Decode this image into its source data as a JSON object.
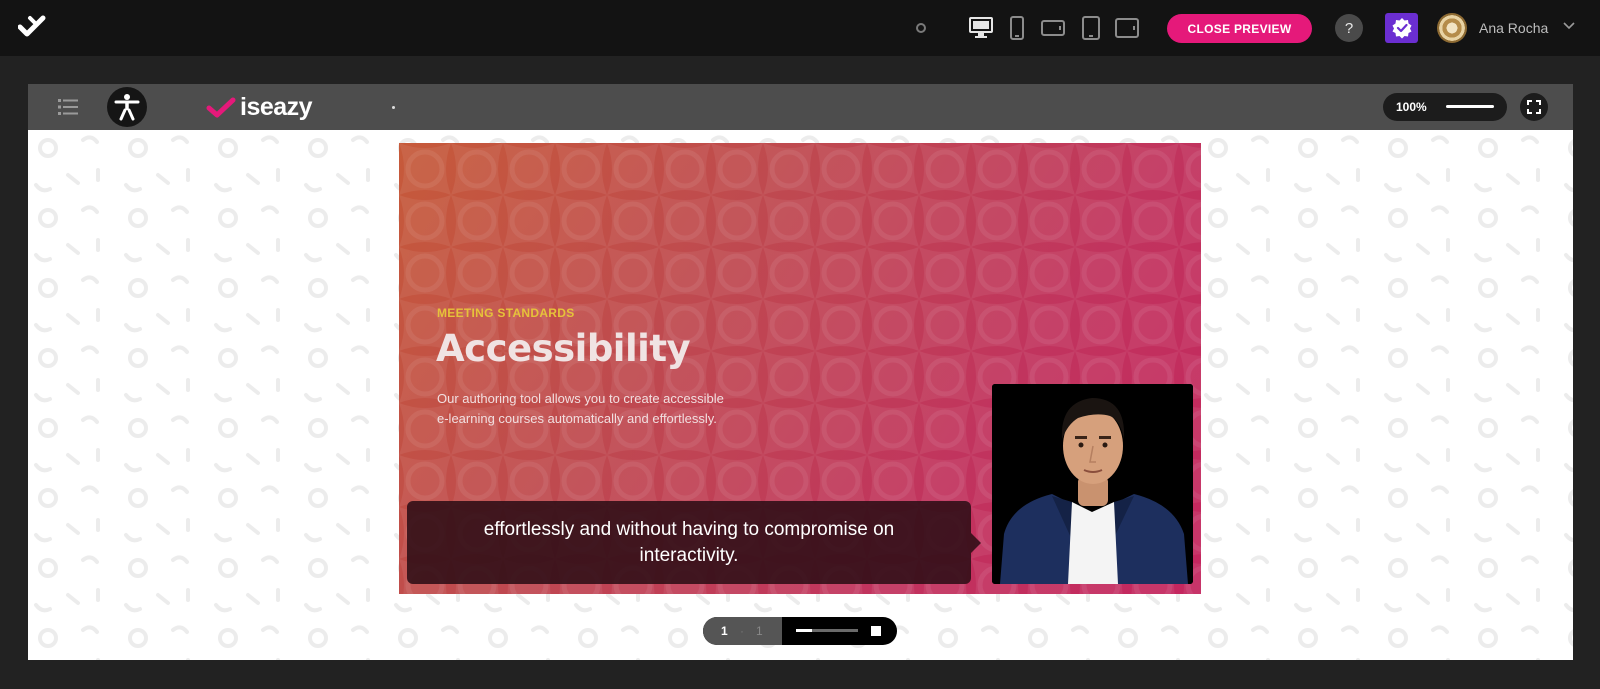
{
  "header": {
    "close_preview_label": "CLOSE PREVIEW",
    "help_label": "?",
    "user_name": "Ana Rocha",
    "devices": [
      "desktop-icon",
      "phone-icon",
      "phone-landscape-icon",
      "tablet-icon",
      "tablet-landscape-icon"
    ],
    "active_device": "desktop-icon"
  },
  "player": {
    "brand_text": "iseazy",
    "zoom_label": "100%"
  },
  "slide": {
    "eyebrow": "MEETING STANDARDS",
    "title": "Accessibility",
    "body_line1": "Our authoring tool allows you to create accessible",
    "body_line2": "e-learning courses automatically and effortlessly.",
    "caption": "effortlessly and without having to compromise on interactivity."
  },
  "pagination": {
    "current": "1",
    "separator": "·",
    "total": "1",
    "progress": 0.25
  },
  "colors": {
    "accent": "#e5197a",
    "badge": "#6b2ed1",
    "eyebrow": "#e6c23a",
    "slide_gradient_start": "#c65a3a",
    "slide_gradient_end": "#c4265f"
  }
}
